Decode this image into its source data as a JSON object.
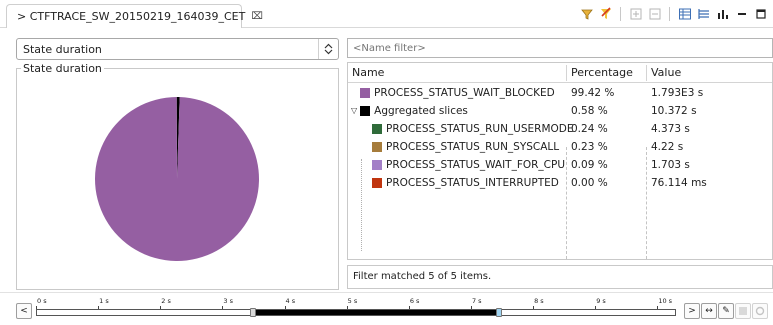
{
  "tab": {
    "title": "> CTFTRACE_SW_20150219_164039_CET",
    "close_glyph": "⌧"
  },
  "toolbar_icons": [
    "filter-icon",
    "highlight-icon",
    "expand-all-icon",
    "collapse-all-icon",
    "table-view-icon",
    "tree-view-icon",
    "chart-view-icon",
    "minimize-icon",
    "maximize-icon"
  ],
  "state_selector": {
    "selected": "State duration"
  },
  "pie_panel": {
    "legend": "State duration",
    "slices": [
      {
        "name": "PROCESS_STATUS_WAIT_BLOCKED",
        "percent": 99.42,
        "color": "#955fa2"
      },
      {
        "name": "Aggregated slices",
        "percent": 0.58,
        "color": "#000000"
      }
    ]
  },
  "filter": {
    "placeholder": "<Name filter>"
  },
  "table": {
    "columns": [
      "Name",
      "Percentage",
      "Value"
    ],
    "rows": [
      {
        "name": "PROCESS_STATUS_WAIT_BLOCKED",
        "percentage": "99.42 %",
        "value": "1.793E3 s",
        "color": "#955fa2",
        "level": 0,
        "expandable": false
      },
      {
        "name": "Aggregated slices",
        "percentage": "0.58 %",
        "value": "10.372 s",
        "color": "#000000",
        "level": 0,
        "expandable": true,
        "expand_glyph": "▽"
      },
      {
        "name": "PROCESS_STATUS_RUN_USERMODE",
        "percentage": "0.24 %",
        "value": "4.373 s",
        "color": "#2f6b3a",
        "level": 1
      },
      {
        "name": "PROCESS_STATUS_RUN_SYSCALL",
        "percentage": "0.23 %",
        "value": "4.22 s",
        "color": "#a67c3b",
        "level": 1
      },
      {
        "name": "PROCESS_STATUS_WAIT_FOR_CPU",
        "percentage": "0.09 %",
        "value": "1.703 s",
        "color": "#a37fc7",
        "level": 1
      },
      {
        "name": "PROCESS_STATUS_INTERRUPTED",
        "percentage": "0.00 %",
        "value": "76.114 ms",
        "color": "#c0350f",
        "level": 1
      }
    ]
  },
  "status": {
    "text": "Filter matched 5 of 5 items."
  },
  "timeline": {
    "ticks": [
      "0 s",
      "1 s",
      "2 s",
      "3 s",
      "4 s",
      "5 s",
      "6 s",
      "7 s",
      "8 s",
      "9 s",
      "10 s"
    ],
    "axis_max_s": 10.3,
    "selection_start_s": 3.5,
    "selection_end_s": 7.45,
    "nav_left_glyph": "<",
    "nav_right_glyph": ">",
    "fit_glyph": "↔",
    "edit_glyph": "✎"
  }
}
